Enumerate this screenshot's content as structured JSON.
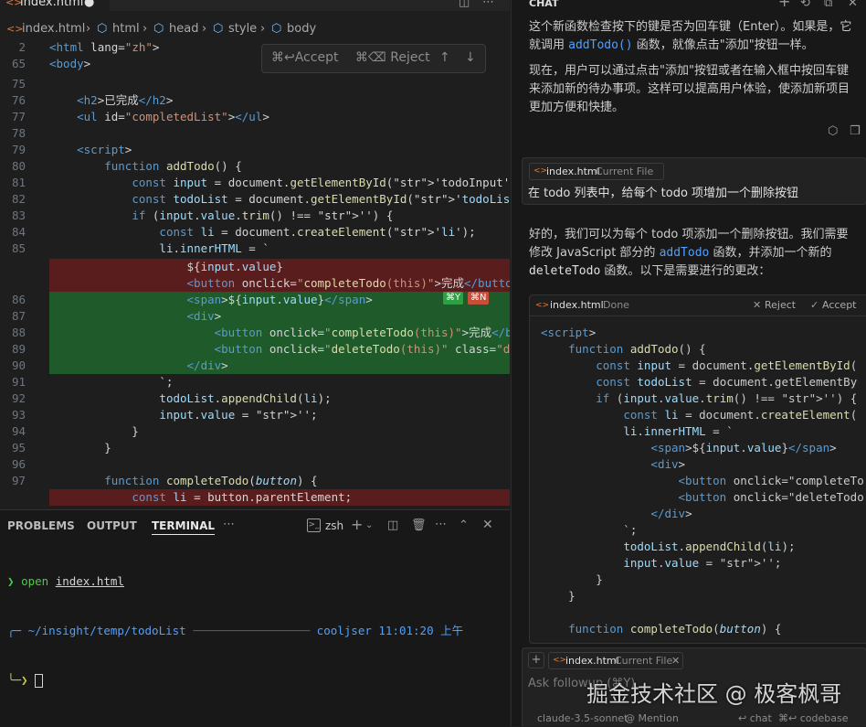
{
  "editor": {
    "tab_name": "index.html",
    "breadcrumb": [
      "index.html",
      "html",
      "head",
      "style",
      "body"
    ],
    "accept_bar": {
      "accept": "⌘↩Accept",
      "reject": "⌘⌫ Reject",
      "up": "↑",
      "down": "↓"
    },
    "diff_pills": {
      "yes": "⌘Y",
      "no": "⌘N"
    },
    "lines": [
      {
        "n": "2",
        "t": "<html lang=\"zh\">"
      },
      {
        "n": "65",
        "t": "<body>"
      },
      {
        "n": "75",
        "t": ""
      },
      {
        "n": "76",
        "t": "    <h2>已完成</h2>"
      },
      {
        "n": "77",
        "t": "    <ul id=\"completedList\"></ul>"
      },
      {
        "n": "78",
        "t": ""
      },
      {
        "n": "79",
        "t": "    <script>"
      },
      {
        "n": "80",
        "t": "        function addTodo() {"
      },
      {
        "n": "81",
        "t": "            const input = document.getElementById('todoInput');"
      },
      {
        "n": "82",
        "t": "            const todoList = document.getElementById('todoList');"
      },
      {
        "n": "83",
        "t": "            if (input.value.trim() !== '') {"
      },
      {
        "n": "84",
        "t": "                const li = document.createElement('li');"
      },
      {
        "n": "85",
        "t": "                li.innerHTML = `"
      },
      {
        "n": "",
        "t": "                    ${input.value}",
        "d": "del"
      },
      {
        "n": "",
        "t": "                    <button onclick=\"completeTodo(this)\">完成</button>",
        "d": "del"
      },
      {
        "n": "86",
        "t": "                    <span>${input.value}</span>",
        "d": "add"
      },
      {
        "n": "87",
        "t": "                    <div>",
        "d": "add"
      },
      {
        "n": "88",
        "t": "                        <button onclick=\"completeTodo(this)\">完成</button>",
        "d": "add"
      },
      {
        "n": "89",
        "t": "                        <button onclick=\"deleteTodo(this)\" class=\"delete\">",
        "d": "add"
      },
      {
        "n": "90",
        "t": "                    </div>",
        "d": "add"
      },
      {
        "n": "91",
        "t": "                `;"
      },
      {
        "n": "92",
        "t": "                todoList.appendChild(li);"
      },
      {
        "n": "93",
        "t": "                input.value = '';"
      },
      {
        "n": "94",
        "t": "            }"
      },
      {
        "n": "95",
        "t": "        }"
      },
      {
        "n": "96",
        "t": ""
      },
      {
        "n": "97",
        "t": "        function completeTodo(button) {"
      },
      {
        "n": "",
        "t": "            const li = button.parentElement;",
        "d": "del"
      }
    ]
  },
  "terminal": {
    "tabs": [
      "PROBLEMS",
      "OUTPUT",
      "TERMINAL"
    ],
    "shell": "zsh",
    "cmd_prompt": "❯",
    "cmd_word": "open",
    "cmd_file": "index.html",
    "path_line": "╭─ ~/insight/temp/todoList",
    "user_time": "cooljser 11:01:20 上午",
    "prompt2": "╰─❯"
  },
  "chat": {
    "header": "CHAT",
    "p1": [
      "这个新函数检查按下的键是否为回车键（Enter）。如果是，它",
      "就调用 ",
      "addTodo()",
      " 函数，就像点击\"添加\"按钮一样。"
    ],
    "p2": "现在，用户可以通过点击\"添加\"按钮或者在输入框中按回车键来添加新的待办事项。这样可以提高用户体验，使添加新项目更加方便和快捷。",
    "user_msg": {
      "file": "index.html",
      "badge": "Current File",
      "text": "在 todo 列表中，给每个 todo 项增加一个删除按钮"
    },
    "p3": [
      "好的，我们可以为每个 todo 项添加一个删除按钮。我们需要修改 JavaScript 部分的 ",
      "addTodo",
      " 函数，并添加一个新的 ",
      "deleteTodo",
      " 函数。以下是需要进行的更改："
    ],
    "code_header": {
      "file": "index.html",
      "status": "Done",
      "reject": "Reject",
      "accept": "Accept"
    },
    "code_lines": [
      "<script>",
      "    function addTodo() {",
      "        const input = document.getElementById(",
      "        const todoList = document.getElementBy",
      "        if (input.value.trim() !== '') {",
      "            const li = document.createElement(",
      "            li.innerHTML = `",
      "                <span>${input.value}</span>",
      "                <div>",
      "                    <button onclick=\"completeTo",
      "                    <button onclick=\"deleteTodo",
      "                </div>",
      "            `;",
      "            todoList.appendChild(li);",
      "            input.value = '';",
      "        }",
      "    }",
      "",
      "    function completeTodo(button) {"
    ],
    "input": {
      "file": "index.html",
      "badge": "Current File",
      "placeholder": "Ask followup (⌘Y)"
    },
    "watermark": "掘金技术社区 @ 极客枫哥",
    "footer": {
      "model": "claude-3.5-sonnet",
      "mention": "@ Mention",
      "chat": "↩ chat",
      "codebase": "⌘↩ codebase"
    }
  }
}
